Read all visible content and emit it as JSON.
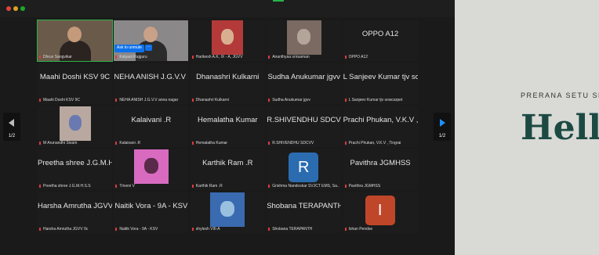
{
  "meeting": {
    "tiles": [
      {
        "name": "",
        "label": "Dhruv Sangvikar",
        "video": true,
        "active": true
      },
      {
        "name": "",
        "label": "Kalyani Rajguru",
        "video": true
      },
      {
        "name": "",
        "label": "Harikesh A.K, IX - A, JGVV",
        "video": true
      },
      {
        "name": "",
        "label": "Ananthyaa sriraaman",
        "video": true
      },
      {
        "name": "OPPO A12",
        "label": "OPPO A12"
      },
      {
        "name": "Maahi Doshi KSV 9C",
        "label": "Maahi Doshi KSV 9C"
      },
      {
        "name": "NEHA ANISH J.G.V.V a...",
        "label": "NEHA ANISH J.G.V.V anna nagar"
      },
      {
        "name": "Dhanashri Kulkarni",
        "label": "Dhanashri Kulkarni"
      },
      {
        "name": "Sudha Anukumar jgvv",
        "label": "Sudha Anukumar jgvv"
      },
      {
        "name": "L Sanjeev Kumar tjv so...",
        "label": "L Sanjeev Kumar tjv sowcarpet"
      },
      {
        "name": "",
        "label": "M Arunandhi Sivam",
        "video": true
      },
      {
        "name": "Kalaivani .R",
        "label": "Kalaivani .R"
      },
      {
        "name": "Hemalatha Kumar",
        "label": "Hemalatha Kumar"
      },
      {
        "name": "R.SHIVENDHU SDCVV",
        "label": "R.SHIVENDHU SDCVV"
      },
      {
        "name": "Prachi Phukan, V.K.V ,...",
        "label": "Prachi Phukan, V.K.V , Tingrai"
      },
      {
        "name": "Preetha shree J.G.M.H...",
        "label": "Preetha shree J.G.M.H.S.S"
      },
      {
        "name": "",
        "label": "Triveni V",
        "video": true
      },
      {
        "name": "Karthik Ram .R",
        "label": "Karthik Ram .R"
      },
      {
        "name": "R",
        "label": "Grishma Nandoskar SVJCT EMS, Sa...",
        "avatar": true,
        "avatarColor": "#2b6cb0"
      },
      {
        "name": "Pavithra JGMHSS",
        "label": "Pavithra JGMHSS"
      },
      {
        "name": "Harsha Amrutha JGVV...",
        "label": "Harsha Amrutha JGVV 9c"
      },
      {
        "name": "Naitik Vora - 9A - KSV",
        "label": "Naitik Vora - 9A - KSV"
      },
      {
        "name": "",
        "label": "shylesh VIII-A",
        "video": true
      },
      {
        "name": "Shobana TERAPANTH",
        "label": "Shobana TERAPANTH"
      },
      {
        "name": "I",
        "label": "Ishan Pendse",
        "avatar": true,
        "avatarColor": "#c0462a"
      }
    ],
    "ask_unmute": "Ask to unmute",
    "ask_unmute_more": "···",
    "page_left": "1/2",
    "page_right": "1/2"
  },
  "share": {
    "subtitle": "PRERANA SETU SPE",
    "title": "Hello"
  }
}
